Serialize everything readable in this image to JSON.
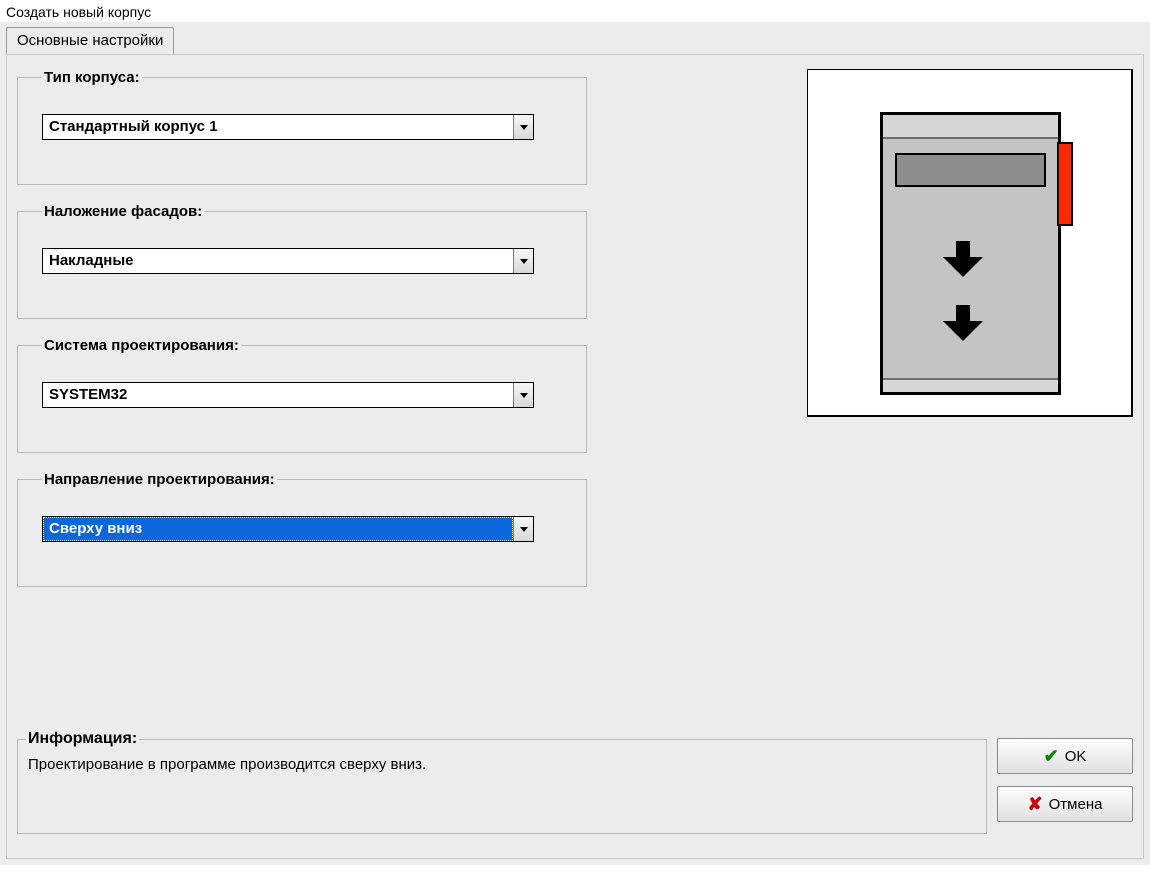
{
  "window_title": "Создать новый корпус",
  "tab_label": "Основные настройки",
  "groups": {
    "type": {
      "legend": "Тип корпуса:",
      "value": "Стандартный корпус 1"
    },
    "overlay": {
      "legend": "Наложение фасадов:",
      "value": "Накладные"
    },
    "system": {
      "legend": "Система проектирования:",
      "value": "SYSTEM32"
    },
    "dir": {
      "legend": "Направление проектирования:",
      "value": "Сверху вниз"
    }
  },
  "info": {
    "legend": "Информация:",
    "text": "Проектирование в программе производится сверху вниз."
  },
  "buttons": {
    "ok": "OK",
    "cancel": "Отмена"
  }
}
